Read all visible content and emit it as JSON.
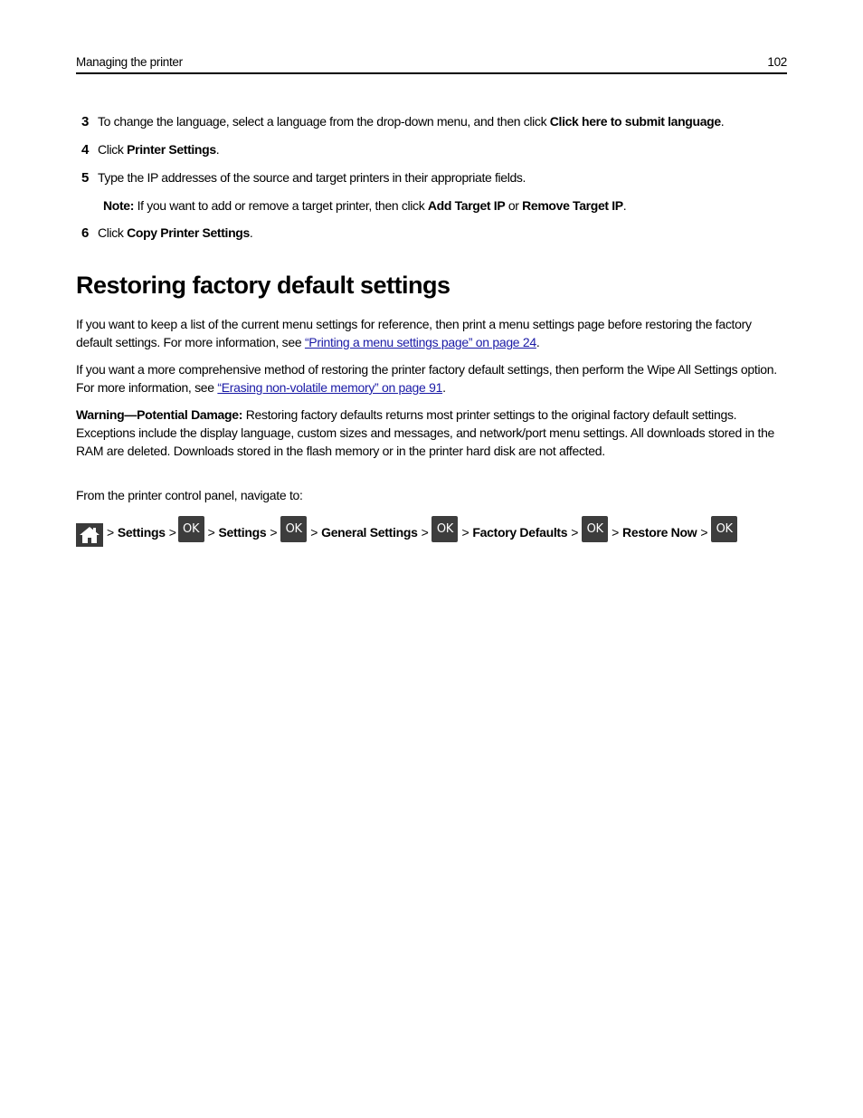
{
  "header": {
    "section": "Managing the printer",
    "page_number": "102"
  },
  "steps": [
    {
      "num": "3",
      "pre": "To change the language, select a language from the drop-down menu, and then click ",
      "bold": "Click here to submit language",
      "post": "."
    },
    {
      "num": "4",
      "pre": "Click ",
      "bold": "Printer Settings",
      "post": "."
    },
    {
      "num": "5",
      "pre": "Type the IP addresses of the source and target printers in their appropriate fields.",
      "bold": "",
      "post": ""
    },
    {
      "num": "6",
      "pre": "Click ",
      "bold": "Copy Printer Settings",
      "post": "."
    }
  ],
  "note": {
    "label": "Note:",
    "pre": " If you want to add or remove a target printer, then click ",
    "bold1": "Add Target IP",
    "mid": " or ",
    "bold2": "Remove Target IP",
    "post": "."
  },
  "section": {
    "title": "Restoring factory default settings",
    "para1": {
      "pre": "If you want to keep a list of the current menu settings for reference, then print a menu settings page before restoring the factory default settings. For more information, see ",
      "link": "“Printing a menu settings page” on page 24",
      "post": "."
    },
    "para2": {
      "pre": "If you want a more comprehensive method of restoring the printer factory default settings, then perform the Wipe All Settings option. For more information, see ",
      "link": "“Erasing non-volatile memory” on page 91",
      "post": "."
    },
    "warning": {
      "label": "Warning—Potential Damage:",
      "text": " Restoring factory defaults returns most printer settings to the original factory default settings. Exceptions include the display language, custom sizes and messages, and network/port menu settings. All downloads stored in the RAM are deleted. Downloads stored in the flash memory or in the printer hard disk are not affected."
    },
    "navigate_intro": "From the printer control panel, navigate to:"
  },
  "nav_path": {
    "home_icon": "home-icon",
    "ok_label": "OK",
    "separator": ">",
    "items": [
      "Settings",
      "Settings",
      "General Settings",
      "Factory Defaults",
      "Restore Now"
    ]
  },
  "colors": {
    "link": "#1a1aa6",
    "button_bg": "#3d3d3d"
  }
}
